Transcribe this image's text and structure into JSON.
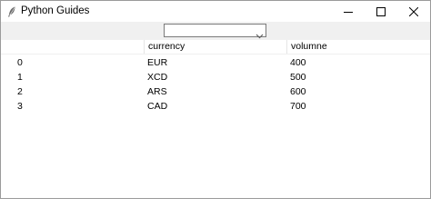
{
  "window": {
    "title": "Python Guides",
    "icon": "feather-icon",
    "controls": [
      "minimize-icon",
      "maximize-icon",
      "close-icon"
    ]
  },
  "toolbar": {
    "combobox": {
      "value": "",
      "icon": "chevron-down-icon"
    }
  },
  "table": {
    "columns": [
      "",
      "currency",
      "volumne"
    ],
    "rows": [
      {
        "index": "0",
        "currency": "EUR",
        "volumne": "400"
      },
      {
        "index": "1",
        "currency": "XCD",
        "volumne": "500"
      },
      {
        "index": "2",
        "currency": "ARS",
        "volumne": "600"
      },
      {
        "index": "3",
        "currency": "CAD",
        "volumne": "700"
      }
    ]
  }
}
